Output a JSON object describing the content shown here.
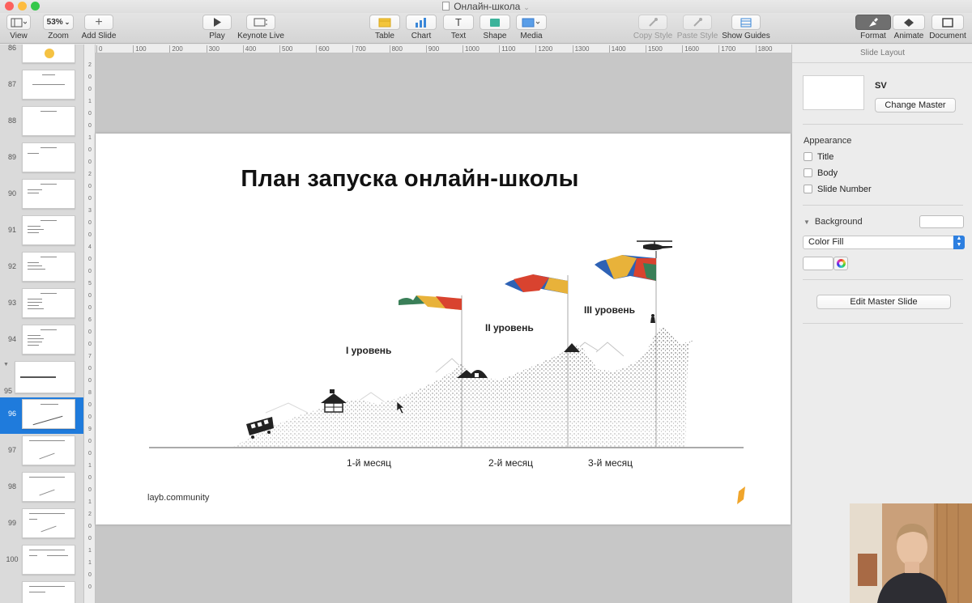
{
  "window": {
    "title": "Онлайн-школа"
  },
  "toolbar": {
    "view": "View",
    "zoom_value": "53%",
    "zoom": "Zoom",
    "add_slide": "Add Slide",
    "play": "Play",
    "keynote_live": "Keynote Live",
    "table": "Table",
    "chart": "Chart",
    "text": "Text",
    "shape": "Shape",
    "media": "Media",
    "copy_style": "Copy Style",
    "paste_style": "Paste Style",
    "show_guides": "Show Guides",
    "format": "Format",
    "animate": "Animate",
    "document": "Document"
  },
  "navigator": {
    "slide_numbers": [
      "86",
      "87",
      "88",
      "89",
      "90",
      "91",
      "92",
      "93",
      "94",
      "95",
      "96",
      "97",
      "98",
      "99",
      "100"
    ],
    "selected": "96"
  },
  "ruler": {
    "horizontal": [
      "0",
      "100",
      "200",
      "300",
      "400",
      "500",
      "600",
      "700",
      "800",
      "900",
      "1000",
      "1100",
      "1200",
      "1300",
      "1400",
      "1500",
      "1600",
      "1700",
      "1800",
      "19"
    ],
    "vertical": [
      "2",
      "0",
      "0",
      "1",
      "0",
      "0",
      "1",
      "0",
      "0",
      "2",
      "0",
      "0",
      "3",
      "0",
      "0",
      "4",
      "0",
      "0",
      "5",
      "0",
      "0",
      "6",
      "0",
      "0",
      "7",
      "0",
      "0",
      "8",
      "0",
      "0",
      "9",
      "0",
      "0",
      "1",
      "0",
      "0",
      "1",
      "2",
      "0",
      "0",
      "1",
      "1",
      "0",
      "0"
    ]
  },
  "slide": {
    "title": "План запуска онлайн-школы",
    "levels": [
      "I уровень",
      "II уровень",
      "III уровень"
    ],
    "months": [
      "1-й месяц",
      "2-й месяц",
      "3-й месяц"
    ],
    "footer": "layb.community"
  },
  "inspector": {
    "panel_title": "Slide Layout",
    "master_name": "SV",
    "change_master": "Change Master",
    "appearance": "Appearance",
    "opt_title": "Title",
    "opt_body": "Body",
    "opt_slide_number": "Slide Number",
    "background": "Background",
    "fill_type": "Color Fill",
    "edit_master": "Edit Master Slide"
  },
  "colors": {
    "selection_blue": "#1f7bdc",
    "accent_orange": "#f0a52b"
  }
}
